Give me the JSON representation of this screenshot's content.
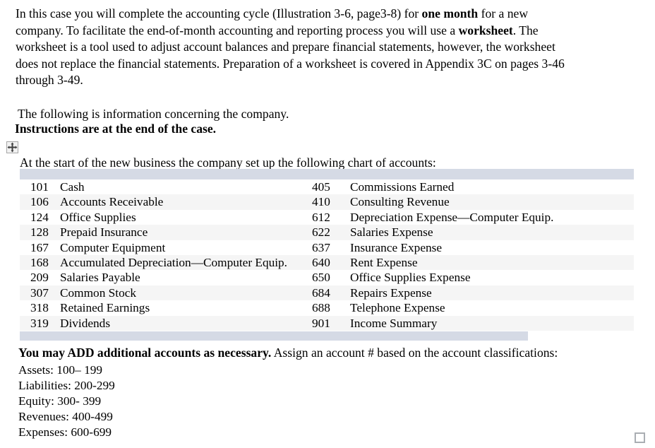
{
  "document": {
    "intro_paragraph": {
      "seg1": "In this case you will complete the accounting cycle (Illustration 3-6, page3-8) for ",
      "bold1": "one month",
      "seg2": " for a new company. To facilitate the end-of-month accounting and reporting process you will use a ",
      "bold2": "worksheet",
      "seg3": ". The worksheet is a tool used to adjust account balances and prepare financial statements, however, the worksheet does not replace the financial statements.  Preparation of a worksheet is covered in Appendix 3C on pages 3-46 through 3-49."
    },
    "info_line": "The following is information concerning the company.",
    "instructions_line": "Instructions are at the end of the case.",
    "chart_intro_line": "At the start of the new business the company set up the following chart of accounts:",
    "icons": {
      "table_move_handle": "move-handle-icon",
      "table_resize_handle": "resize-handle-icon"
    }
  },
  "accounts_table": {
    "header_band_color": "#d5dae5",
    "shaded_row_color": "#f5f5f5",
    "rows": [
      {
        "left_num": "101",
        "left_name": "Cash",
        "right_num": "405",
        "right_name": "Commissions Earned"
      },
      {
        "left_num": "106",
        "left_name": "Accounts Receivable",
        "right_num": "410",
        "right_name": "Consulting Revenue"
      },
      {
        "left_num": "124",
        "left_name": "Office Supplies",
        "right_num": "612",
        "right_name": "Depreciation Expense—Computer Equip."
      },
      {
        "left_num": "128",
        "left_name": "Prepaid Insurance",
        "right_num": "622",
        "right_name": "Salaries Expense"
      },
      {
        "left_num": "167",
        "left_name": "Computer Equipment",
        "right_num": "637",
        "right_name": "Insurance Expense"
      },
      {
        "left_num": "168",
        "left_name": "Accumulated Depreciation—Computer Equip.",
        "right_num": "640",
        "right_name": "Rent Expense"
      },
      {
        "left_num": "209",
        "left_name": "Salaries Payable",
        "right_num": "650",
        "right_name": "Office Supplies Expense"
      },
      {
        "left_num": "307",
        "left_name": "Common Stock",
        "right_num": "684",
        "right_name": "Repairs Expense"
      },
      {
        "left_num": "318",
        "left_name": "Retained Earnings",
        "right_num": "688",
        "right_name": "Telephone Expense"
      },
      {
        "left_num": "319",
        "left_name": "Dividends",
        "right_num": "901",
        "right_name": "Income Summary"
      }
    ]
  },
  "footer": {
    "note_bold": "You may ADD additional accounts as necessary.",
    "note_rest": "  Assign an account # based on the account classifications:",
    "classifications": [
      "Assets:  100– 199",
      "Liabilities:  200-299",
      "Equity:  300- 399",
      "Revenues:  400-499",
      "Expenses:  600-699"
    ]
  }
}
